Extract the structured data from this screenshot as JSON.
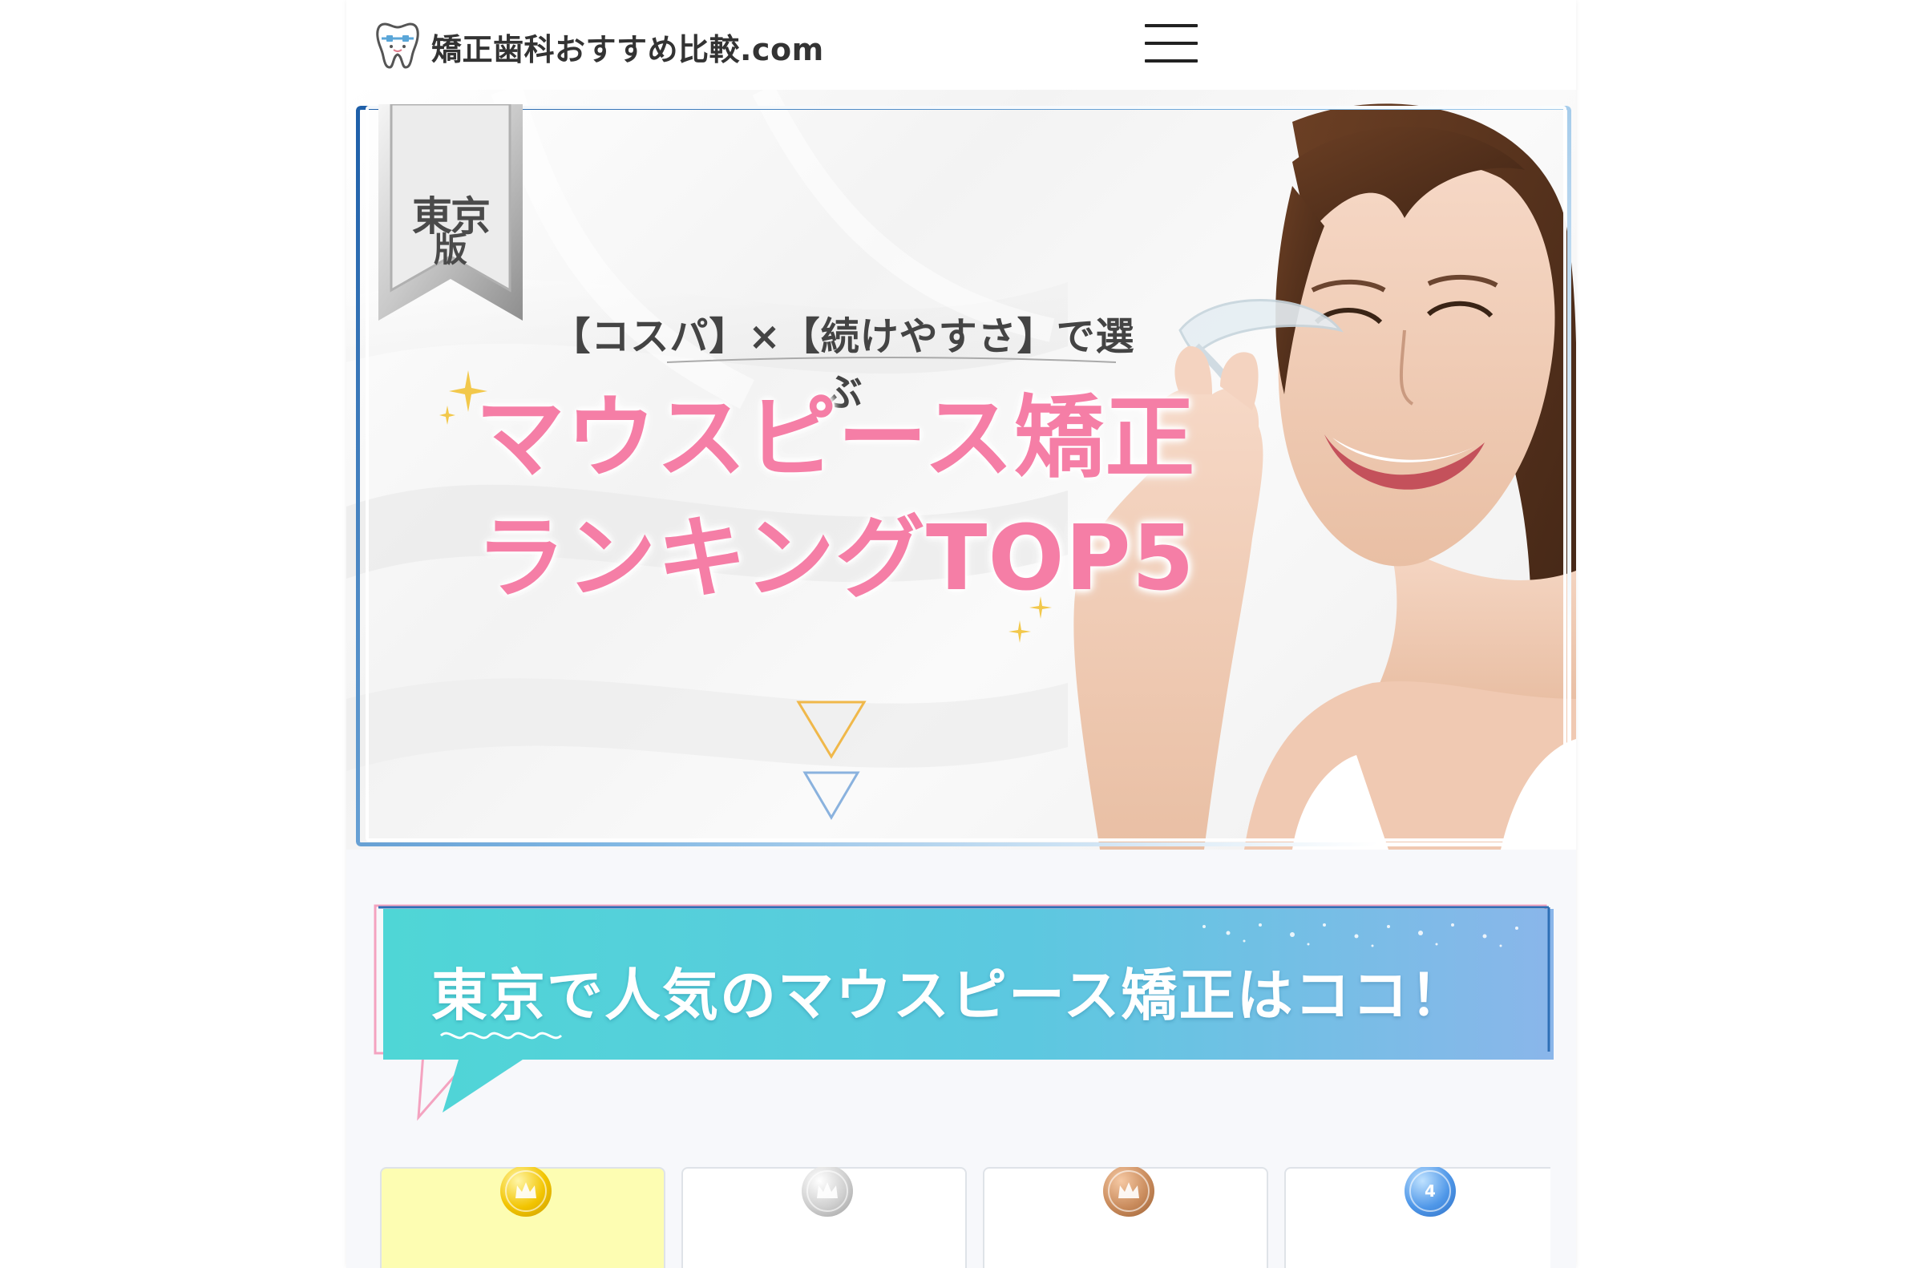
{
  "header": {
    "site_name": "矯正歯科おすすめ比較.com",
    "menu_icon": "hamburger-menu-icon",
    "logo_icon": "tooth-braces-icon"
  },
  "hero": {
    "badge_line1": "東京",
    "badge_line2": "版",
    "subtitle": "【コスパ】×【続けやすさ】で選ぶ",
    "title_line1": "マウスピース矯正",
    "title_line2": "ランキングTOP5"
  },
  "section": {
    "heading": "東京で人気のマウスピース矯正はココ！"
  },
  "ranking_cards": [
    {
      "rank_label": "",
      "medal": "gold",
      "icon": "crown-medal-icon"
    },
    {
      "rank_label": "",
      "medal": "silver",
      "icon": "crown-medal-icon"
    },
    {
      "rank_label": "",
      "medal": "bronze",
      "icon": "crown-medal-icon"
    },
    {
      "rank_label": "4",
      "medal": "blue",
      "icon": "rank-medal-icon"
    }
  ],
  "colors": {
    "title_pink": "#f57ea6",
    "banner_teal": "#4fd6d6",
    "banner_blue": "#8ab6ea",
    "frame_blue": "#1d5ea8"
  }
}
